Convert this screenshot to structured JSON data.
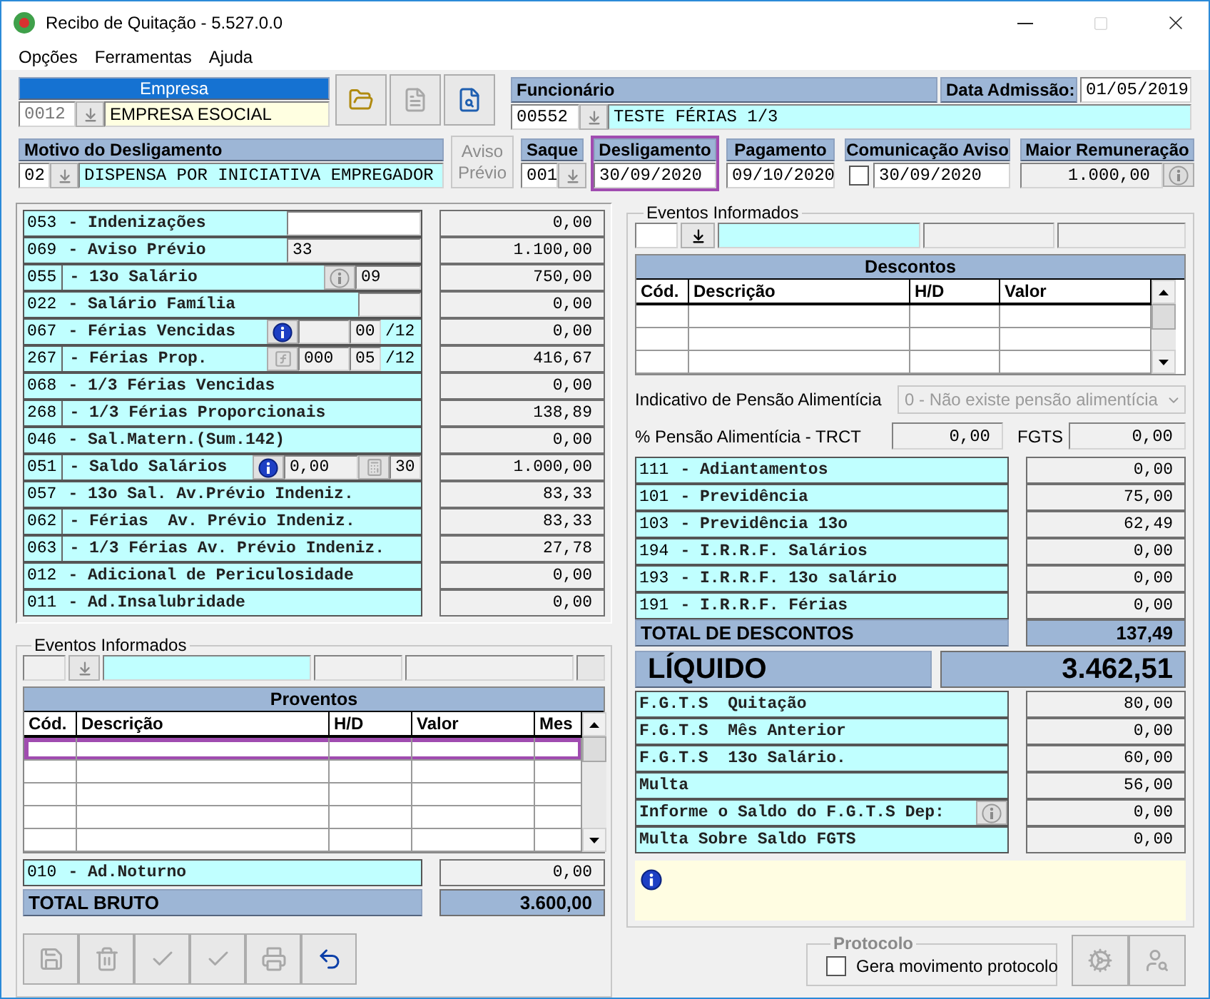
{
  "window": {
    "title": "Recibo de Quitação - 5.527.0.0"
  },
  "menu": [
    "Opções",
    "Ferramentas",
    "Ajuda"
  ],
  "empresa": {
    "label": "Empresa",
    "code": "0012",
    "name": "EMPRESA ESOCIAL"
  },
  "top_buttons": [
    {
      "kind": "open-folder",
      "disabled": false
    },
    {
      "kind": "document",
      "disabled": true
    },
    {
      "kind": "search",
      "disabled": false
    }
  ],
  "funcionario": {
    "label": "Funcionário",
    "code": "00552",
    "name": "TESTE FÉRIAS 1/3",
    "admission_label": "Data Admissão:",
    "admission_date": "01/05/2019"
  },
  "motivo": {
    "label": "Motivo do Desligamento",
    "code": "02",
    "text": "DISPENSA POR INICIATIVA EMPREGADOR"
  },
  "aviso_previo": {
    "label": "Aviso Prévio",
    "disabled": true
  },
  "header_fields": [
    {
      "kind": "select",
      "label": "Saque",
      "value": "001",
      "highlighted": false
    },
    {
      "kind": "date",
      "label": "Desligamento",
      "value": "30/09/2020",
      "highlighted": true
    },
    {
      "kind": "date",
      "label": "Pagamento",
      "value": "09/10/2020",
      "highlighted": false
    },
    {
      "kind": "check-date",
      "label": "Comunicação Aviso",
      "value": "30/09/2020",
      "checked": false,
      "highlighted": false
    },
    {
      "kind": "amount",
      "label": "Maior Remuneração",
      "value": "1.000,00",
      "highlighted": false
    }
  ],
  "earnings": [
    {
      "code": "053",
      "description": "- Indenizações",
      "code_cell": false,
      "extras": [
        {
          "kind": "field",
          "disabled": false
        }
      ],
      "value": "0,00"
    },
    {
      "code": "069",
      "description": "- Aviso Prévio",
      "code_cell": false,
      "extras": [
        {
          "kind": "field",
          "value": "33",
          "disabled": true
        }
      ],
      "value": "1.100,00"
    },
    {
      "code": "055",
      "description": "- 13o Salário",
      "code_cell": true,
      "extras": [
        {
          "kind": "info",
          "disabled": true
        },
        {
          "kind": "field",
          "value": "09",
          "disabled": true
        }
      ],
      "value": "750,00"
    },
    {
      "code": "022",
      "description": "- Salário Família",
      "code_cell": false,
      "extras": [
        {
          "kind": "field",
          "disabled": true
        }
      ],
      "value": "0,00"
    },
    {
      "code": "067",
      "description": "- Férias Vencidas",
      "code_cell": false,
      "extras": [
        {
          "kind": "info",
          "disabled": false
        },
        {
          "kind": "field",
          "disabled": true
        },
        {
          "kind": "field",
          "value": "00",
          "disabled": true
        },
        {
          "kind": "text",
          "value": "/12"
        }
      ],
      "value": "0,00"
    },
    {
      "code": "267",
      "description": "- Férias Prop.",
      "code_cell": true,
      "extras": [
        {
          "kind": "formula-button",
          "disabled": true
        },
        {
          "kind": "field",
          "value": "000",
          "disabled": true
        },
        {
          "kind": "field",
          "value": "05",
          "disabled": true
        },
        {
          "kind": "text",
          "value": "/12"
        }
      ],
      "value": "416,67"
    },
    {
      "code": "068",
      "description": "- 1/3 Férias Vencidas",
      "code_cell": false,
      "value": "0,00"
    },
    {
      "code": "268",
      "description": "- 1/3 Férias Proporcionais",
      "code_cell": true,
      "value": "138,89"
    },
    {
      "code": "046",
      "description": "- Sal.Matern.(Sum.142)",
      "code_cell": false,
      "value": "0,00"
    },
    {
      "code": "051",
      "description": "- Saldo Salários",
      "code_cell": true,
      "extras": [
        {
          "kind": "info",
          "disabled": false
        },
        {
          "kind": "field",
          "value": "0,00",
          "disabled": true
        },
        {
          "kind": "calc-button",
          "disabled": true
        },
        {
          "kind": "field",
          "value": "30",
          "disabled": true
        }
      ],
      "value": "1.000,00"
    },
    {
      "code": "057",
      "description": "- 13o Sal. Av.Prévio Indeniz.",
      "code_cell": false,
      "value": "83,33"
    },
    {
      "code": "062",
      "description": "- Férias  Av. Prévio Indeniz.",
      "code_cell": true,
      "value": "83,33"
    },
    {
      "code": "063",
      "description": "- 1/3 Férias Av. Prévio Indeniz.",
      "code_cell": true,
      "value": "27,78"
    },
    {
      "code": "012",
      "description": "- Adicional de Periculosidade",
      "code_cell": false,
      "value": "0,00"
    },
    {
      "code": "011",
      "description": "- Ad.Insalubridade",
      "code_cell": false,
      "value": "0,00"
    }
  ],
  "left_events": {
    "title": "Eventos Informados"
  },
  "proventos": {
    "title": "Proventos",
    "columns": [
      "Cód.",
      "Descrição",
      "H/D",
      "Valor",
      "Mes"
    ],
    "rows": [
      {
        "highlighted": true
      },
      {
        "highlighted": false
      },
      {
        "highlighted": false
      },
      {
        "highlighted": false
      },
      {
        "highlighted": false
      }
    ]
  },
  "ad_noturno": {
    "code": "010",
    "description": "- Ad.Noturno",
    "value": "0,00"
  },
  "total_bruto": {
    "label": "TOTAL BRUTO",
    "value": "3.600,00"
  },
  "bottom_buttons": [
    {
      "kind": "save",
      "disabled": true
    },
    {
      "kind": "delete",
      "disabled": true
    },
    {
      "kind": "confirm",
      "disabled": true
    },
    {
      "kind": "confirm",
      "disabled": true
    },
    {
      "kind": "print",
      "disabled": true
    },
    {
      "kind": "undo",
      "disabled": false
    }
  ],
  "right_events": {
    "title": "Eventos Informados"
  },
  "descontos": {
    "title": "Descontos",
    "columns": [
      "Cód.",
      "Descrição",
      "H/D",
      "Valor"
    ],
    "rows": [
      {
        "highlighted": false
      },
      {
        "highlighted": false
      },
      {
        "highlighted": false
      }
    ]
  },
  "pensao": {
    "label": "Indicativo de Pensão Alimentícia",
    "value": "0 - Não existe pensão alimentícia",
    "disabled": true
  },
  "pensao_percent": {
    "label": "% Pensão Alimentícia - TRCT",
    "value": "0,00"
  },
  "fgts": {
    "label": "FGTS",
    "value": "0,00"
  },
  "deductions": [
    {
      "code": "111",
      "description": "- Adiantamentos",
      "value": "0,00"
    },
    {
      "code": "101",
      "description": "- Previdência",
      "value": "75,00"
    },
    {
      "code": "103",
      "description": "- Previdência 13o",
      "value": "62,49"
    },
    {
      "code": "194",
      "description": "- I.R.R.F. Salários",
      "value": "0,00"
    },
    {
      "code": "193",
      "description": "- I.R.R.F. 13o salário",
      "value": "0,00"
    },
    {
      "code": "191",
      "description": "- I.R.R.F. Férias",
      "value": "0,00"
    }
  ],
  "total_descontos": {
    "label": "TOTAL DE DESCONTOS",
    "value": "137,49"
  },
  "liquido": {
    "label": "LÍQUIDO",
    "value": "3.462,51"
  },
  "fgts_rows": [
    {
      "label": "F.G.T.S  Quitação",
      "value": "80,00",
      "info": false
    },
    {
      "label": "F.G.T.S  Mês Anterior",
      "value": "0,00",
      "info": false
    },
    {
      "label": "F.G.T.S  13o Salário.",
      "value": "60,00",
      "info": false
    },
    {
      "label": "Multa",
      "value": "56,00",
      "info": false
    },
    {
      "label": "Informe o Saldo do F.G.T.S Dep:",
      "value": "0,00",
      "info": true
    },
    {
      "label": "Multa Sobre Saldo FGTS",
      "value": "0,00",
      "info": false
    }
  ],
  "protocolo": {
    "title": "Protocolo",
    "checkbox_label": "Gera movimento protocolo",
    "checked": false
  },
  "action_buttons": [
    {
      "kind": "settings",
      "disabled": true
    },
    {
      "kind": "user-search",
      "disabled": true
    }
  ]
}
